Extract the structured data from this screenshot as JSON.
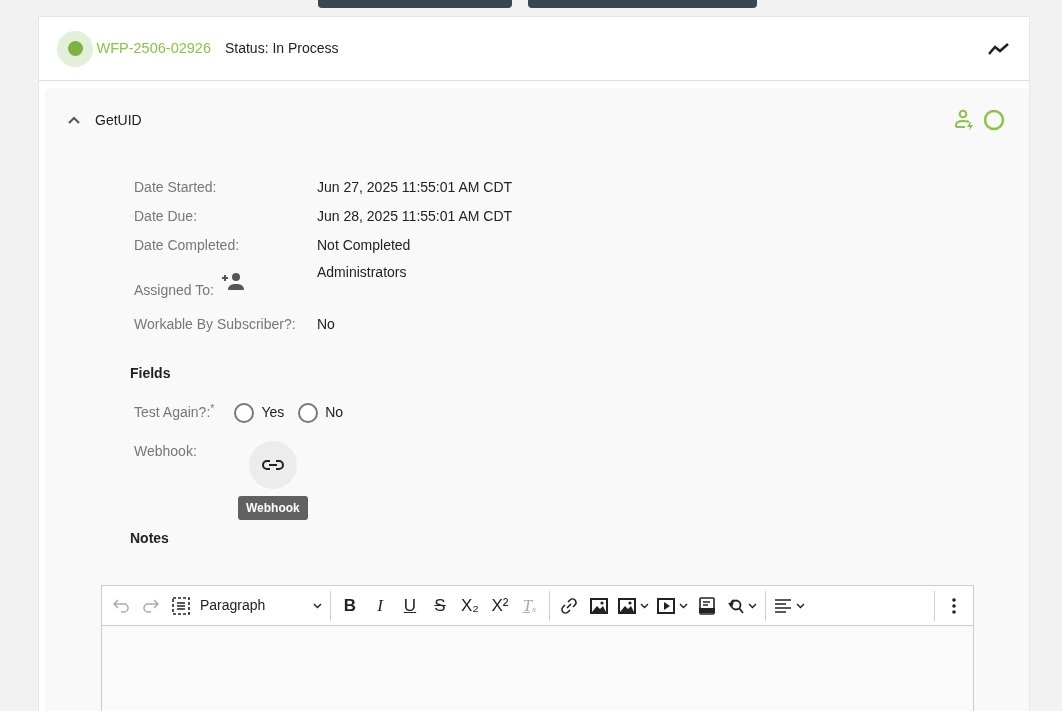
{
  "header": {
    "id": "WFP-2506-02926",
    "status": "Status: In Process"
  },
  "step": {
    "title": "GetUID",
    "expanded": true,
    "details": [
      {
        "label": "Date Started:",
        "value": "Jun 27, 2025 11:55:01 AM CDT"
      },
      {
        "label": "Date Due:",
        "value": "Jun 28, 2025 11:55:01 AM CDT"
      },
      {
        "label": "Date Completed:",
        "value": "Not Completed"
      },
      {
        "label": "Assigned To:",
        "value": "Administrators",
        "kind": "assign"
      },
      {
        "label": "Workable By Subscriber?:",
        "value": "No"
      }
    ],
    "fields_heading": "Fields",
    "radio_field": {
      "label": "Test Again?:",
      "required_mark": "*",
      "options": [
        {
          "label": "Yes",
          "selected": false
        },
        {
          "label": "No",
          "selected": false
        }
      ]
    },
    "webhook_field": {
      "label": "Webhook:",
      "tooltip": "Webhook"
    },
    "notes_heading": "Notes",
    "editor": {
      "format": "Paragraph",
      "toolbar": [
        {
          "kind": "undo",
          "disabled": true
        },
        {
          "kind": "redo",
          "disabled": true
        },
        {
          "kind": "select-all",
          "disabled": false
        },
        {
          "kind": "sep"
        },
        {
          "kind": "bold",
          "label": "B",
          "disabled": false
        },
        {
          "kind": "italic",
          "label": "I",
          "disabled": false
        },
        {
          "kind": "underline",
          "label": "U",
          "disabled": false
        },
        {
          "kind": "strike",
          "label": "S",
          "disabled": false
        },
        {
          "kind": "sub",
          "label": "X₂",
          "disabled": false
        },
        {
          "kind": "sup",
          "label": "X²",
          "disabled": false
        },
        {
          "kind": "clear",
          "label": "Tₓ",
          "disabled": true
        },
        {
          "kind": "sep"
        },
        {
          "kind": "link",
          "disabled": false
        },
        {
          "kind": "image",
          "disabled": false
        },
        {
          "kind": "image-menu",
          "disabled": false
        },
        {
          "kind": "media-menu",
          "disabled": false
        },
        {
          "kind": "html",
          "disabled": false
        },
        {
          "kind": "find-menu",
          "disabled": false
        },
        {
          "kind": "sep"
        },
        {
          "kind": "align-menu",
          "disabled": false
        },
        {
          "kind": "sep"
        },
        {
          "kind": "more",
          "disabled": false
        }
      ]
    }
  }
}
